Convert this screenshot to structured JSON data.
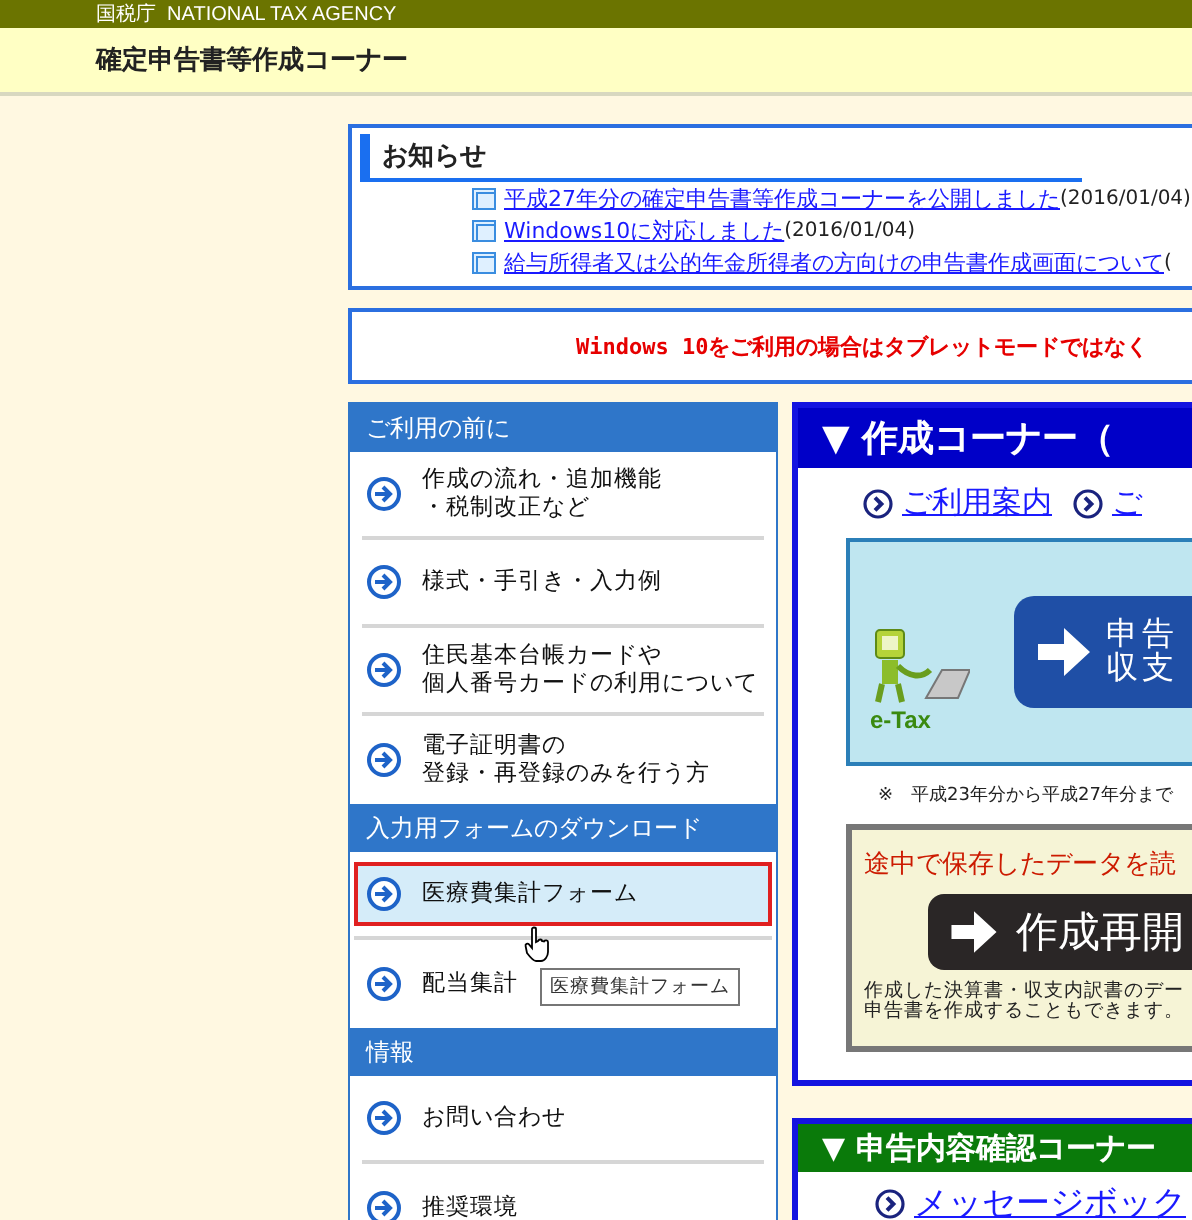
{
  "agency_bar": {
    "text": "国税庁  NATIONAL TAX AGENCY"
  },
  "site_title": "確定申告書等作成コーナー",
  "notices": {
    "title": "お知らせ",
    "items": [
      {
        "link": "平成27年分の確定申告書等作成コーナーを公開しました",
        "date": "(2016/01/04)"
      },
      {
        "link": "Windows10に対応しました",
        "date": "(2016/01/04)"
      },
      {
        "link": "給与所得者又は公的年金所得者の方向けの申告書作成画面について",
        "date": "("
      }
    ]
  },
  "alert_banner": "Windows 10をご利用の場合はタブレットモードではなく",
  "sidebar": [
    {
      "heading": "ご利用の前に",
      "items": [
        {
          "lines": [
            "作成の流れ・追加機能",
            "・税制改正など"
          ],
          "selected": false
        },
        {
          "lines": [
            "様式・手引き・入力例"
          ],
          "selected": false
        },
        {
          "lines": [
            "住民基本台帳カードや",
            "個人番号カードの利用について"
          ],
          "selected": false
        },
        {
          "lines": [
            "電子証明書の",
            "登録・再登録のみを行う方"
          ],
          "selected": false
        }
      ]
    },
    {
      "heading": "入力用フォームのダウンロード",
      "items": [
        {
          "lines": [
            "医療費集計フォーム"
          ],
          "selected": true
        },
        {
          "lines": [
            "配当集計"
          ],
          "selected": false
        }
      ]
    },
    {
      "heading": "情報",
      "items": [
        {
          "lines": [
            "お問い合わせ"
          ],
          "selected": false
        },
        {
          "lines": [
            "推奨環境"
          ],
          "selected": false
        }
      ]
    }
  ],
  "tooltip": "医療費集計フォーム",
  "creation_corner": {
    "title": "▼ 作成コーナー（",
    "links": [
      "ご利用案内",
      "ご"
    ],
    "etax_banner": {
      "logo": "e-Tax",
      "button_lines": [
        "申告",
        "収支"
      ]
    },
    "note": "※　平成23年分から平成27年分まで",
    "resume": {
      "heading": "途中で保存したデータを読",
      "button": "作成再開",
      "description": [
        "作成した決算書・収支内訳書のデー",
        "申告書を作成することもできます。"
      ]
    }
  },
  "confirm_corner": {
    "title": "▼ 申告内容確認コーナー",
    "links": [
      "メッセージボック"
    ]
  }
}
